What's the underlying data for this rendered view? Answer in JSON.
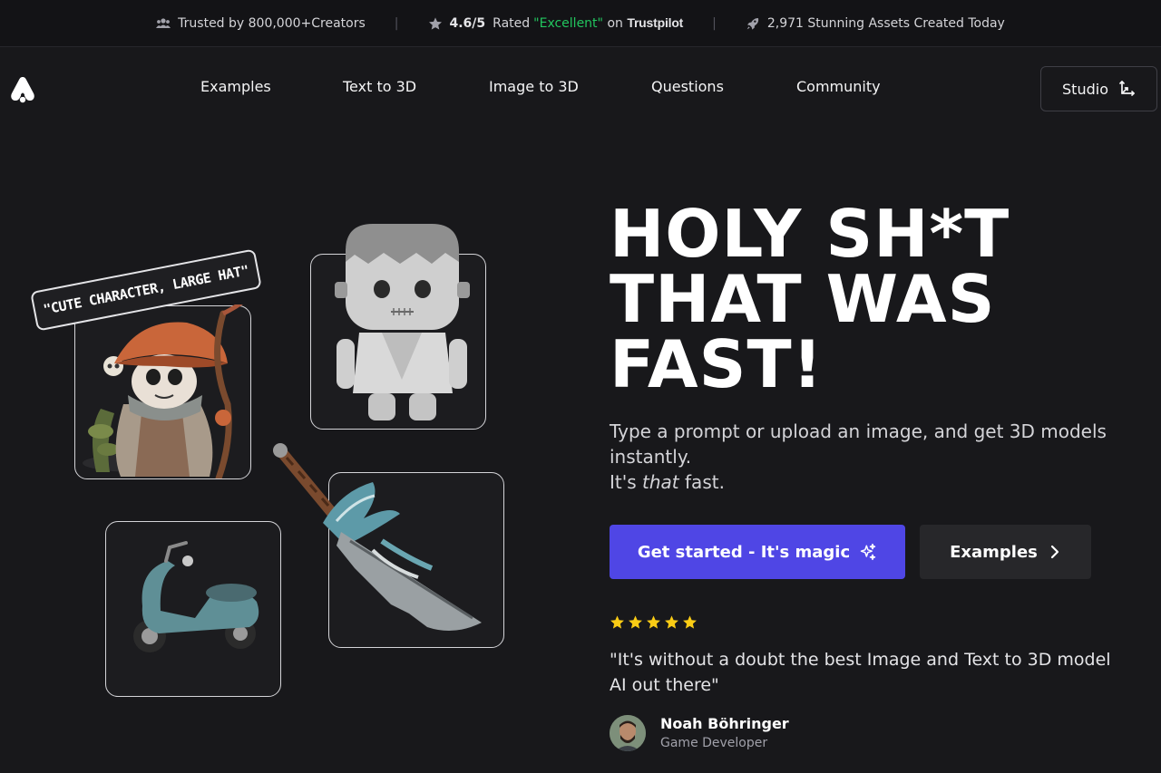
{
  "topbar": {
    "creators": "Trusted by 800,000+Creators",
    "rating_score": "4.6/5",
    "rated_prefix": "Rated",
    "rated_value": "\"Excellent\"",
    "rated_on": "on",
    "trustpilot": "Trustpilot",
    "assets": "2,971 Stunning Assets Created Today",
    "separator": "|"
  },
  "nav": {
    "links": [
      "Examples",
      "Text to 3D",
      "Image to 3D",
      "Questions",
      "Community"
    ],
    "studio": "Studio"
  },
  "hero": {
    "title_lines": [
      "HOLY SH*T",
      "THAT WAS",
      "FAST!"
    ],
    "subtitle_line1": "Type a prompt or upload an image, and get 3D models instantly.",
    "subtitle_it": "It's",
    "subtitle_that": "that",
    "subtitle_fast": "fast.",
    "primary_button": "Get started - It's magic",
    "secondary_button": "Examples"
  },
  "gallery": {
    "prompt_tag": "\"CUTE CHARACTER, LARGE HAT\""
  },
  "testimonial": {
    "stars": 5,
    "star_color": "#facc15",
    "quote": "\"It's without a doubt the best Image and Text to 3D model AI out there\"",
    "author": "Noah Böhringer",
    "role": "Game Developer"
  },
  "colors": {
    "accent": "#4f46e5",
    "excellent": "#22c55e"
  }
}
